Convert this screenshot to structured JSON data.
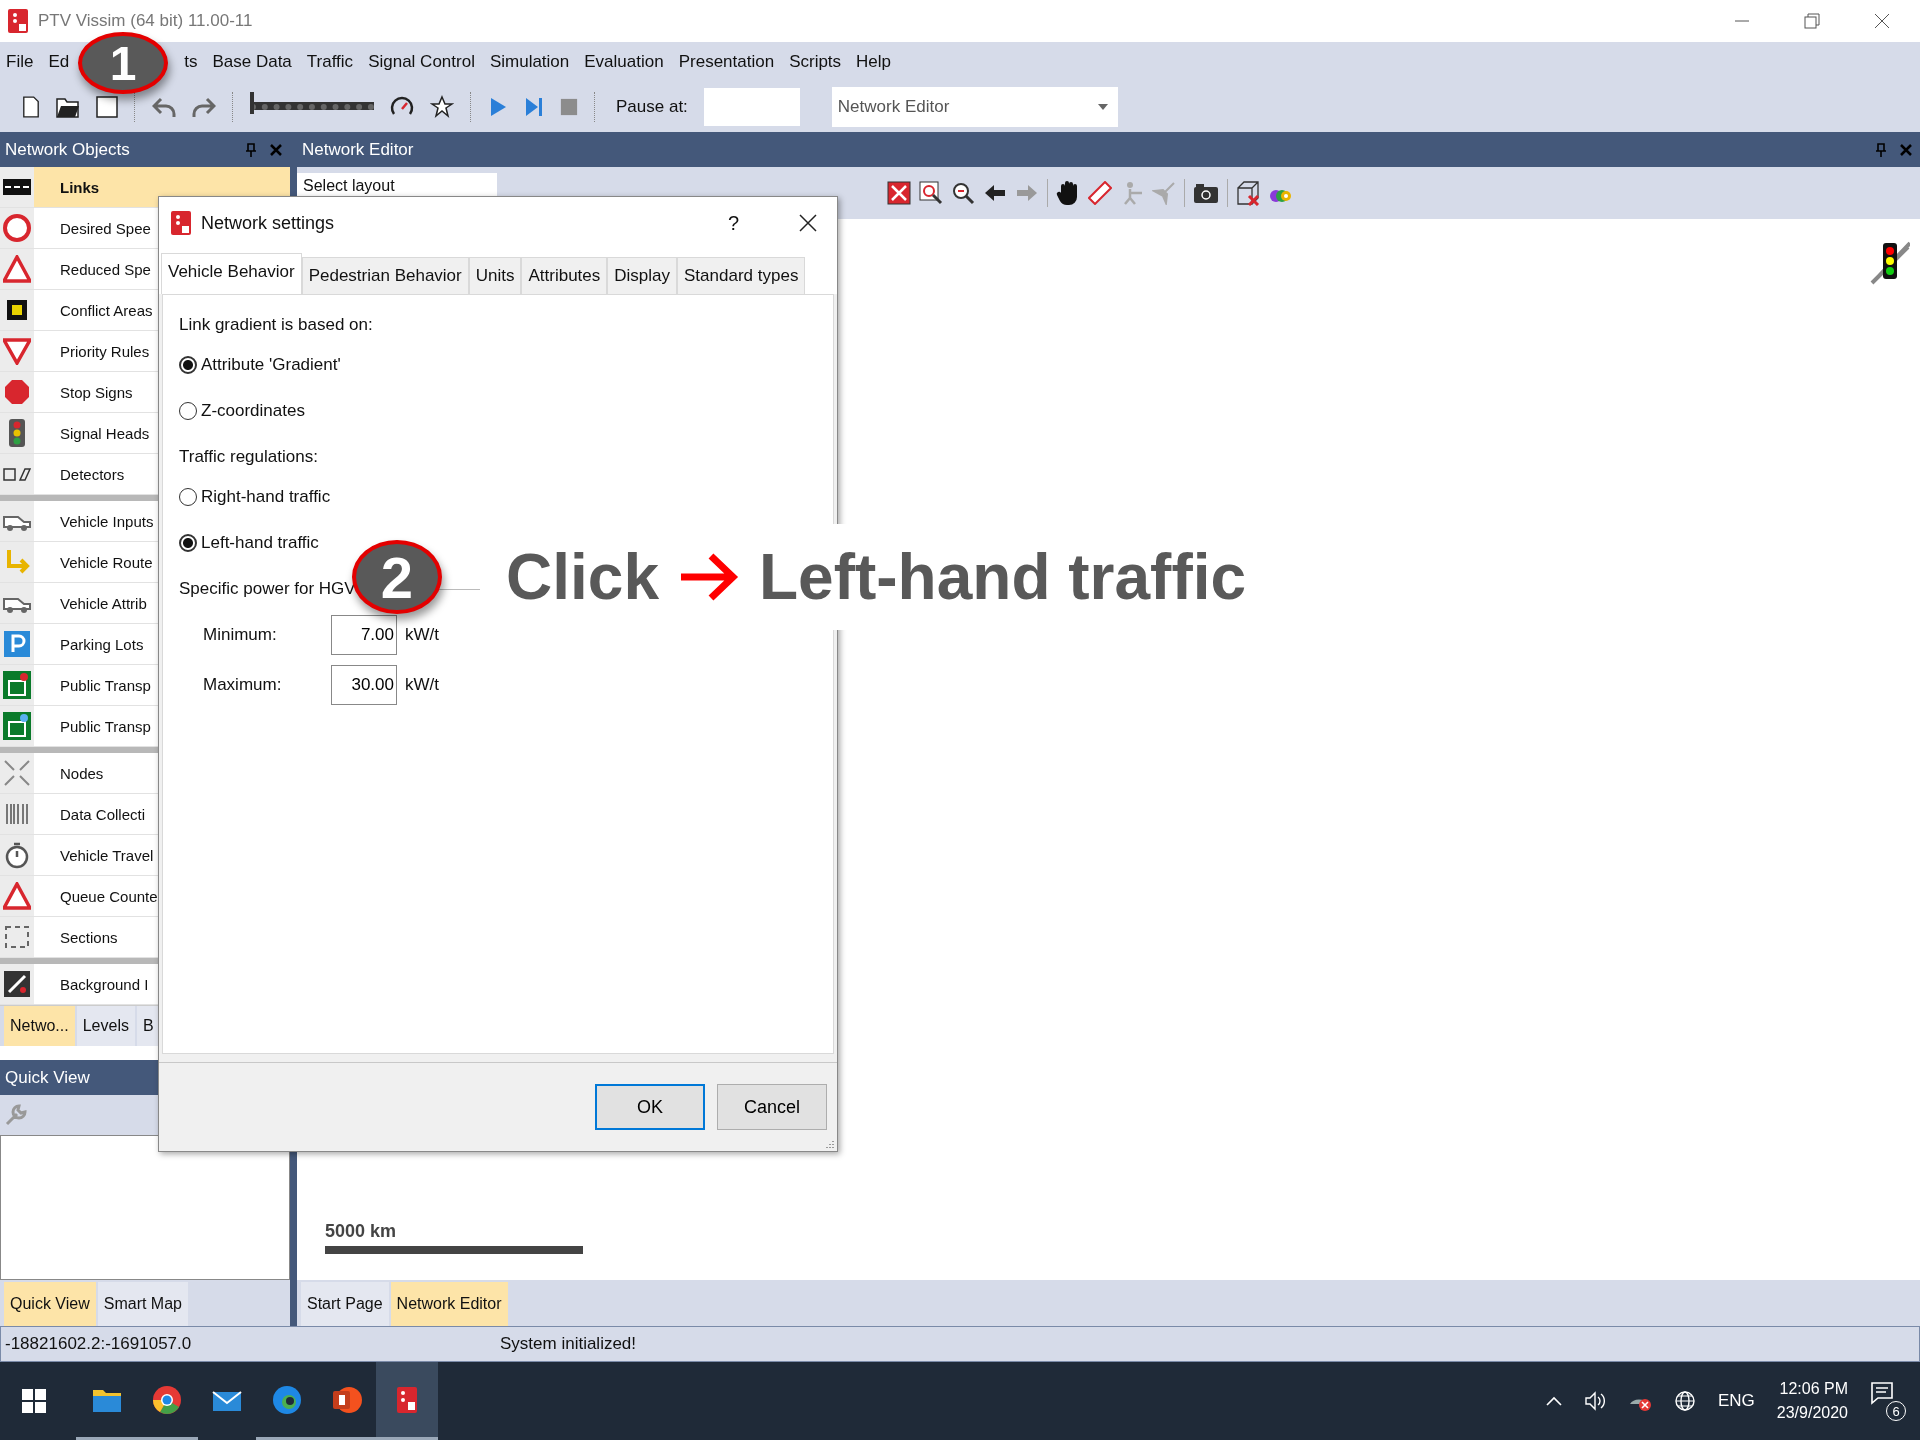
{
  "window": {
    "title": "PTV Vissim (64 bit) 11.00-11"
  },
  "menu": [
    "File",
    "Ed",
    "ts",
    "Base Data",
    "Traffic",
    "Signal Control",
    "Simulation",
    "Evaluation",
    "Presentation",
    "Scripts",
    "Help"
  ],
  "toolbar": {
    "speed_slider": {
      "level": 0
    },
    "pause_label": "Pause at:",
    "view_select": "Network Editor"
  },
  "network_objects": {
    "title": "Network Objects",
    "groups": [
      {
        "items": [
          {
            "label": "Links",
            "selected": true
          },
          {
            "label": "Desired Spee",
            "selected": false
          },
          {
            "label": "Reduced Spe",
            "selected": false
          },
          {
            "label": "Conflict Areas",
            "selected": false
          },
          {
            "label": "Priority Rules",
            "selected": false
          },
          {
            "label": "Stop Signs",
            "selected": false
          },
          {
            "label": "Signal Heads",
            "selected": false
          },
          {
            "label": "Detectors",
            "selected": false
          }
        ]
      },
      {
        "items": [
          {
            "label": "Vehicle Inputs",
            "selected": false
          },
          {
            "label": "Vehicle Route",
            "selected": false
          },
          {
            "label": "Vehicle Attrib",
            "selected": false
          },
          {
            "label": "Parking Lots",
            "selected": false
          },
          {
            "label": "Public Transp",
            "selected": false
          },
          {
            "label": "Public Transp",
            "selected": false
          }
        ]
      },
      {
        "items": [
          {
            "label": "Nodes",
            "selected": false
          },
          {
            "label": "Data Collecti",
            "selected": false
          },
          {
            "label": "Vehicle Travel",
            "selected": false
          },
          {
            "label": "Queue Counte",
            "selected": false
          },
          {
            "label": "Sections",
            "selected": false
          }
        ]
      },
      {
        "items": [
          {
            "label": "Background I",
            "selected": false
          }
        ]
      }
    ],
    "tabs": [
      {
        "label": "Netwo...",
        "selected": true
      },
      {
        "label": "Levels",
        "selected": false
      },
      {
        "label": "B",
        "selected": false
      }
    ]
  },
  "quick_view": {
    "title": "Quick View",
    "tabs": [
      {
        "label": "Quick View",
        "selected": true
      },
      {
        "label": "Smart Map",
        "selected": false
      }
    ]
  },
  "network_editor": {
    "title": "Network Editor",
    "layout_select": "Select layout",
    "scale_label": "5000 km",
    "tabs": [
      {
        "label": "Start Page",
        "selected": false
      },
      {
        "label": "Network Editor",
        "selected": true
      }
    ]
  },
  "dialog": {
    "title": "Network settings",
    "help": "?",
    "tabs": [
      {
        "label": "Vehicle Behavior",
        "selected": true
      },
      {
        "label": "Pedestrian Behavior",
        "selected": false
      },
      {
        "label": "Units",
        "selected": false
      },
      {
        "label": "Attributes",
        "selected": false
      },
      {
        "label": "Display",
        "selected": false
      },
      {
        "label": "Standard types",
        "selected": false
      }
    ],
    "gradient": {
      "label": "Link gradient is based on:",
      "options": [
        {
          "label": "Attribute 'Gradient'",
          "selected": true
        },
        {
          "label": "Z-coordinates",
          "selected": false
        }
      ]
    },
    "traffic": {
      "label": "Traffic regulations:",
      "options": [
        {
          "label": "Right-hand traffic",
          "selected": false
        },
        {
          "label": "Left-hand traffic",
          "selected": true
        }
      ]
    },
    "hgv": {
      "label": "Specific power for HGV",
      "fields": [
        {
          "label": "Minimum:",
          "value": "7.00",
          "unit": "kW/t"
        },
        {
          "label": "Maximum:",
          "value": "30.00",
          "unit": "kW/t"
        }
      ]
    },
    "buttons": [
      {
        "label": "OK",
        "default": true
      },
      {
        "label": "Cancel",
        "default": false
      }
    ]
  },
  "status_bar": {
    "coordinates": "-18821602.2:-1691057.0",
    "message": "System initialized!"
  },
  "taskbar": {
    "apps": [
      {
        "open": true,
        "selected": false
      },
      {
        "open": true,
        "selected": false
      },
      {
        "open": false,
        "selected": false
      },
      {
        "open": true,
        "selected": false
      },
      {
        "open": true,
        "selected": false
      },
      {
        "open": true,
        "selected": true
      }
    ],
    "language": "ENG",
    "time": "12:06 PM",
    "date": "23/9/2020",
    "notification_count": "6"
  },
  "steps": [
    {
      "badge": "1"
    },
    {
      "badge": "2",
      "action": "Click",
      "target": "Left-hand traffic"
    }
  ]
}
